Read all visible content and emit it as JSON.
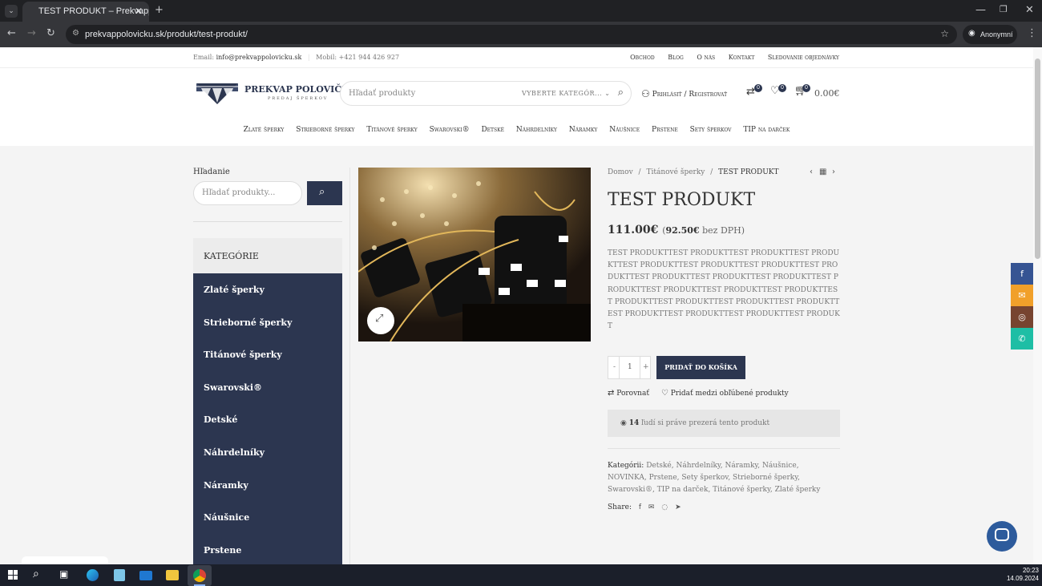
{
  "browser": {
    "tab_title": "TEST PRODUKT – Prekvappolov",
    "url": "prekvappolovicku.sk/produkt/test-produkt/",
    "profile": "Anonymní"
  },
  "topbar": {
    "email_label": "Email:",
    "email": "info@prekvappolovicku.sk",
    "phone_label": "Mobil:",
    "phone": "+421 944 426 927",
    "links": [
      "Obchod",
      "Blog",
      "O nás",
      "Kontakt",
      "Sledovanie objednávky"
    ]
  },
  "header": {
    "logo_title": "PREKVAP POLOVIČKU",
    "logo_sub": "PREDAJ ŠPERKOV",
    "search_placeholder": "Hľadať produkty",
    "category_select": "VYBERTE KATEGÓR...",
    "login": "Prihlásiť / Registrovať",
    "compare_count": "0",
    "wishlist_count": "0",
    "cart_count": "0",
    "cart_total": "0.00€"
  },
  "nav": [
    "Zlaté šperky",
    "Strieborné šperky",
    "Titánové šperky",
    "Swarovski®",
    "Detské",
    "Náhrdelníky",
    "Náramky",
    "Náušnice",
    "Prstene",
    "Sety šperkov",
    "TIP na darček"
  ],
  "sidebar": {
    "search_title": "Hľadanie",
    "search_placeholder": "Hľadať produkty...",
    "categories_title": "KATEGÓRIE",
    "categories": [
      "Zlaté šperky",
      "Strieborné šperky",
      "Titánové šperky",
      "Swarovski®",
      "Detské",
      "Náhrdelníky",
      "Náramky",
      "Náušnice",
      "Prstene"
    ]
  },
  "product": {
    "breadcrumb": [
      "Domov",
      "Titánové šperky",
      "TEST PRODUKT"
    ],
    "title": "TEST PRODUKT",
    "price": "111.00€",
    "price_ex_open": "(",
    "price_ex_value": "92.50€",
    "price_ex_label": "bez DPH)",
    "description": "TEST PRODUKTTEST PRODUKTTEST PRODUKTTEST PRODUKTTEST PRODUKTTEST PRODUKTTEST PRODUKTTEST PRODUKTTEST PRODUKTTEST PRODUKTTEST PRODUKTTEST PRODUKTTEST PRODUKTTEST PRODUKTTEST PRODUKTTEST PRODUKTTEST PRODUKTTEST PRODUKTTEST PRODUKTTEST PRODUKTTEST PRODUKTTEST PRODUKTTEST PRODUKT",
    "qty_minus": "-",
    "qty": "1",
    "qty_plus": "+",
    "add_to_cart": "PRIDAŤ DO KOŠÍKA",
    "compare": "Porovnať",
    "wishlist": "Pridať medzi obľúbené produkty",
    "viewers_count": "14",
    "viewers_text": "ľudí si práve prezerá tento produkt",
    "categories_label": "Kategórii:",
    "categories": "Detské, Náhrdelníky, Náramky, Náušnice, NOVINKA, Prstene, Sety šperkov, Strieborné šperky, Swarovski®, TIP na darček, Titánové šperky, Zlaté šperky",
    "share_label": "Share:"
  },
  "taskbar": {
    "time": "20:23",
    "date": "14.09.2024"
  },
  "colors": {
    "navy": "#2c3650",
    "facebook": "#365493",
    "email": "#f1a02a",
    "instagram": "#774430",
    "whatsapp": "#1ebea5"
  }
}
